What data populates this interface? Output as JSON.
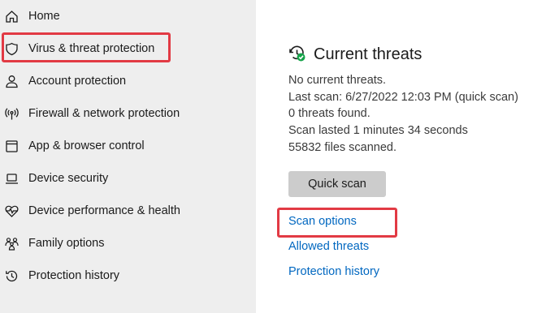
{
  "sidebar": {
    "items": [
      {
        "label": "Home",
        "icon": "home-icon"
      },
      {
        "label": "Virus & threat protection",
        "icon": "shield-icon"
      },
      {
        "label": "Account protection",
        "icon": "person-icon"
      },
      {
        "label": "Firewall & network protection",
        "icon": "antenna-icon"
      },
      {
        "label": "App & browser control",
        "icon": "app-window-icon"
      },
      {
        "label": "Device security",
        "icon": "laptop-icon"
      },
      {
        "label": "Device performance & health",
        "icon": "heart-pulse-icon"
      },
      {
        "label": "Family options",
        "icon": "family-icon"
      },
      {
        "label": "Protection history",
        "icon": "history-icon"
      }
    ]
  },
  "main": {
    "section_title": "Current threats",
    "status": "No current threats.",
    "last_scan": "Last scan: 6/27/2022 12:03 PM (quick scan)",
    "threats_found": "0 threats found.",
    "scan_duration": "Scan lasted 1 minutes 34 seconds",
    "files_scanned": "55832 files scanned.",
    "quick_scan_label": "Quick scan",
    "links": {
      "scan_options": "Scan options",
      "allowed_threats": "Allowed threats",
      "protection_history": "Protection history"
    }
  },
  "colors": {
    "sidebar_bg": "#eeeeee",
    "highlight": "#e23a44",
    "link": "#0067c0",
    "button_bg": "#cccccc",
    "status_ok": "#16a34a"
  }
}
